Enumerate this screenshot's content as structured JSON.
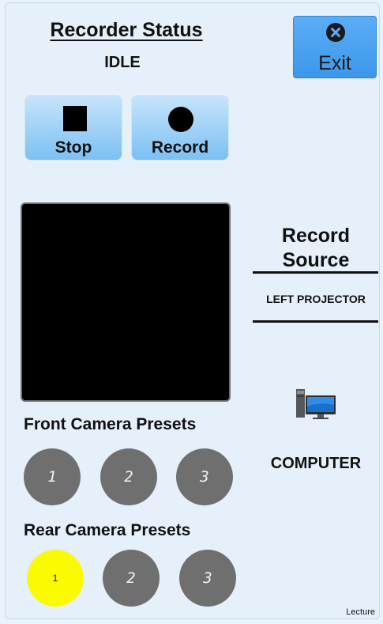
{
  "recorder": {
    "title": "Recorder Status",
    "status": "IDLE"
  },
  "exit": {
    "label": "Exit",
    "icon": "close-circle-icon"
  },
  "controls": {
    "stop_label": "Stop",
    "record_label": "Record"
  },
  "record_source": {
    "title": "Record Source",
    "value": "LEFT PROJECTOR",
    "input_label": "COMPUTER",
    "input_icon": "computer-icon"
  },
  "front_presets": {
    "label": "Front Camera Presets",
    "items": [
      "1",
      "2",
      "3"
    ],
    "selected": null
  },
  "rear_presets": {
    "label": "Rear Camera Presets",
    "items": [
      "1",
      "2",
      "3"
    ],
    "selected": "1"
  },
  "footer": {
    "mode": "Lecture"
  },
  "colors": {
    "background": "#e5f0fa",
    "exit_button": "#4aa3ef",
    "preset_inactive": "#6f6f6f",
    "preset_active": "#fafa00"
  }
}
